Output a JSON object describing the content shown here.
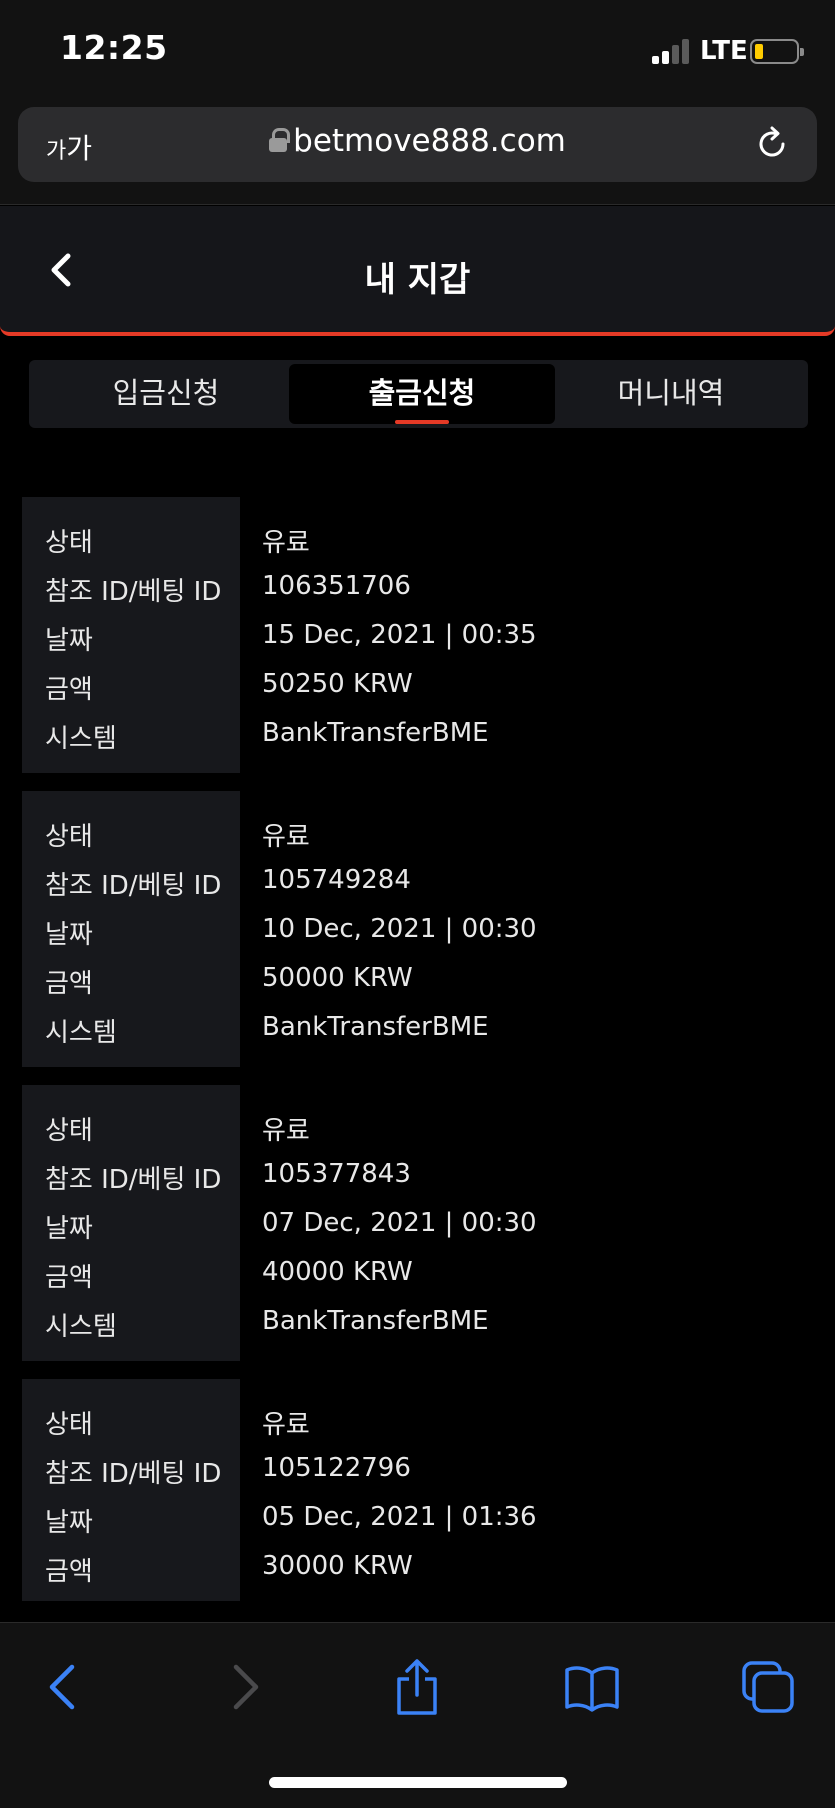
{
  "status_bar": {
    "time": "12:25",
    "network": "LTE"
  },
  "browser": {
    "reader_label_small": "가",
    "reader_label_large": "가",
    "url": "betmove888.com"
  },
  "header": {
    "title": "내 지갑"
  },
  "tabs": [
    {
      "label": "입금신청",
      "active": false
    },
    {
      "label": "출금신청",
      "active": true
    },
    {
      "label": "머니내역",
      "active": false
    }
  ],
  "labels": {
    "status": "상태",
    "ref_id": "참조 ID/베팅 ID",
    "date": "날짜",
    "amount": "금액",
    "system": "시스템"
  },
  "records": [
    {
      "status": "유료",
      "ref_id": "106351706",
      "date": "15 Dec, 2021 | 00:35",
      "amount": "50250 KRW",
      "system": "BankTransferBME"
    },
    {
      "status": "유료",
      "ref_id": "105749284",
      "date": "10 Dec, 2021 | 00:30",
      "amount": "50000 KRW",
      "system": "BankTransferBME"
    },
    {
      "status": "유료",
      "ref_id": "105377843",
      "date": "07 Dec, 2021 | 00:30",
      "amount": "40000 KRW",
      "system": "BankTransferBME"
    },
    {
      "status": "유료",
      "ref_id": "105122796",
      "date": "05 Dec, 2021 | 01:36",
      "amount": "30000 KRW",
      "system": ""
    }
  ],
  "toolbar": {
    "icons": [
      "back-icon",
      "forward-icon",
      "share-icon",
      "bookmarks-icon",
      "tabs-icon"
    ]
  },
  "colors": {
    "accent": "#e53a26",
    "ios_blue": "#3b82f6",
    "battery": "#ffcc00"
  }
}
